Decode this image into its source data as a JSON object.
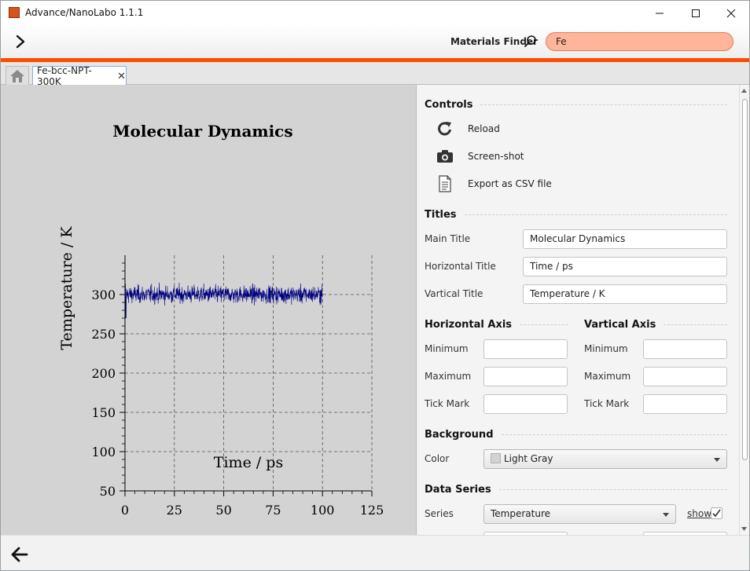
{
  "window": {
    "title": "Advance/NanoLabo 1.1.1"
  },
  "toolbar": {
    "finder_label": "Materials Finder",
    "search_value": "Fe"
  },
  "tabs": [
    {
      "label": "Fe-bcc-NPT-300K"
    }
  ],
  "controls": {
    "section_title": "Controls",
    "actions": [
      "Reload",
      "Screen-shot",
      "Export as CSV file"
    ]
  },
  "titles": {
    "section_title": "Titles",
    "main_title_label": "Main Title",
    "main_title_value": "Molecular Dynamics",
    "horizontal_title_label": "Horizontal Title",
    "horizontal_title_value": "Time / ps",
    "vertical_title_label": "Vartical Title",
    "vertical_title_value": "Temperature / K"
  },
  "axes": {
    "horizontal": {
      "title": "Horizontal Axis",
      "min_label": "Minimum",
      "max_label": "Maximum",
      "tick_label": "Tick Mark",
      "min": "",
      "max": "",
      "tick": ""
    },
    "vertical": {
      "title": "Vartical Axis",
      "min_label": "Minimum",
      "max_label": "Maximum",
      "tick_label": "Tick Mark",
      "min": "",
      "max": "",
      "tick": ""
    }
  },
  "background": {
    "section_title": "Background",
    "color_label": "Color",
    "color_value": "Light Gray",
    "swatch": "#d3d3d3"
  },
  "data_series": {
    "section_title": "Data Series",
    "series_label": "Series",
    "series_value": "Temperature",
    "show_label": "show",
    "show_checked": true
  },
  "colors": {
    "accent": "#ff4a00",
    "search_bg": "#ffb59a",
    "chart_bg": "#d3d3d3",
    "series": "#000080"
  },
  "chart_data": {
    "type": "line",
    "title": "Molecular Dynamics",
    "xlabel": "Time / ps",
    "ylabel": "Temperature / K",
    "xlim": [
      0,
      125
    ],
    "ylim": [
      50,
      350
    ],
    "xticks": [
      0,
      25,
      50,
      75,
      100,
      125
    ],
    "yticks": [
      50,
      100,
      150,
      200,
      250,
      300
    ],
    "grid": true,
    "series": [
      {
        "x_range": [
          0,
          100
        ],
        "mean": 300,
        "fluctuation": 10,
        "initial_min": 268,
        "initial_max": 330,
        "color": "#000080"
      }
    ]
  }
}
